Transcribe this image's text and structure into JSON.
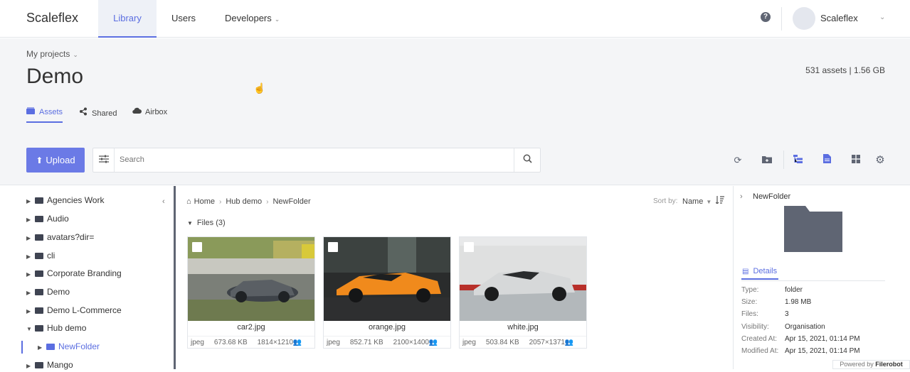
{
  "app": {
    "brand": "Scaleflex"
  },
  "nav": {
    "tabs": [
      {
        "label": "Library"
      },
      {
        "label": "Users"
      },
      {
        "label": "Developers"
      }
    ],
    "user_name": "Scaleflex",
    "help": "?"
  },
  "header": {
    "breadcrumb": "My projects",
    "title": "Demo",
    "stats": "531 assets | 1.56 GB",
    "subtabs": [
      {
        "label": "Assets"
      },
      {
        "label": "Shared"
      },
      {
        "label": "Airbox"
      }
    ]
  },
  "toolbar": {
    "upload_label": "Upload",
    "search_placeholder": "Search"
  },
  "tree": {
    "items": [
      {
        "label": "Agencies Work"
      },
      {
        "label": "Audio"
      },
      {
        "label": "avatars?dir="
      },
      {
        "label": "cli"
      },
      {
        "label": "Corporate Branding"
      },
      {
        "label": "Demo"
      },
      {
        "label": "Demo L-Commerce"
      },
      {
        "label": "Hub demo"
      },
      {
        "label": "NewFolder"
      },
      {
        "label": "Mango"
      }
    ]
  },
  "main": {
    "breadcrumb": [
      "Home",
      "Hub demo",
      "NewFolder"
    ],
    "sort_by_label": "Sort by:",
    "sort_value": "Name",
    "files_header": "Files (3)",
    "files": [
      {
        "name": "car2.jpg",
        "type": "jpeg",
        "size": "673.68 KB",
        "dims": "1814×1210"
      },
      {
        "name": "orange.jpg",
        "type": "jpeg",
        "size": "852.71 KB",
        "dims": "2100×1400"
      },
      {
        "name": "white.jpg",
        "type": "jpeg",
        "size": "503.84 KB",
        "dims": "2057×1371"
      }
    ]
  },
  "details": {
    "title": "NewFolder",
    "tab_label": "Details",
    "rows": [
      {
        "label": "Type:",
        "value": "folder"
      },
      {
        "label": "Size:",
        "value": "1.98 MB"
      },
      {
        "label": "Files:",
        "value": "3"
      },
      {
        "label": "Visibility:",
        "value": "Organisation"
      },
      {
        "label": "Created At:",
        "value": "Apr 15, 2021, 01:14 PM"
      },
      {
        "label": "Modified At:",
        "value": "Apr 15, 2021, 01:14 PM"
      }
    ]
  },
  "footer": {
    "powered_prefix": "Powered by",
    "powered_brand": "Filerobot"
  },
  "colors": {
    "accent": "#5b6ee1",
    "upload": "#6b7ae6",
    "folder": "#3f4452",
    "header_bg": "#f4f5f7"
  },
  "icons": [
    "help-icon",
    "chevron-down-icon",
    "assets-icon",
    "share-icon",
    "cloud-icon",
    "upload-icon",
    "filter-icon",
    "search-icon",
    "refresh-icon",
    "new-folder-icon",
    "tree-view-icon",
    "details-view-icon",
    "grid-view-icon",
    "settings-icon",
    "folder-icon",
    "home-icon",
    "sort-icon",
    "people-icon",
    "chevron-right-icon",
    "chevron-left-icon"
  ]
}
